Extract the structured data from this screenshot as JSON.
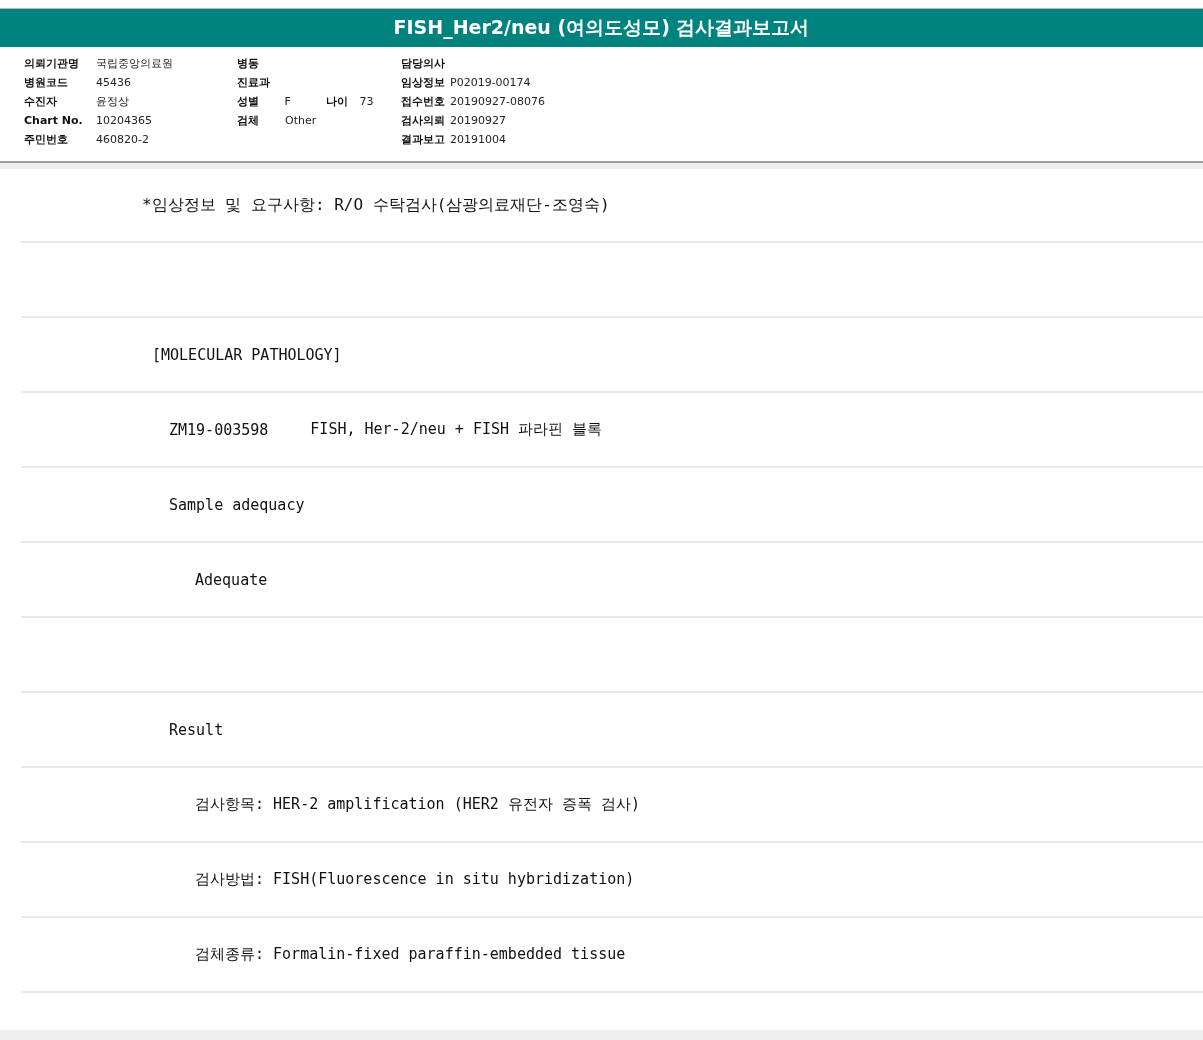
{
  "title": "FISH_Her2/neu (여의도성모) 검사결과보고서",
  "info": [
    [
      {
        "label": "의뢰기관명",
        "value": "국립중앙의료원"
      },
      {
        "label": "병원코드",
        "value": "45436"
      },
      {
        "label": "수진자",
        "value": "윤정상"
      },
      {
        "label": "Chart No.",
        "value": "10204365"
      },
      {
        "label": "주민번호",
        "value": "460820-2"
      }
    ],
    [
      {
        "label": "병동"
      },
      {
        "label": "진료과"
      },
      {
        "label": "성별",
        "value": "F",
        "extra_label": "나이",
        "extra_value": "73"
      },
      {
        "label": "검체",
        "value": "Other"
      }
    ],
    [
      {
        "label": "담당의사"
      },
      {
        "label": "임상정보",
        "value": "P02019-00174"
      },
      {
        "label": "접수번호",
        "value": "20190927-08076"
      },
      {
        "label": "검사의뢰",
        "value": "20190927"
      },
      {
        "label": "결과보고",
        "value": "20191004"
      }
    ]
  ],
  "report": [
    {
      "kind": "note",
      "text": "*임상정보 및 요구사항: R/O 수탁검사(삼광의료재단-조영숙)"
    },
    {
      "kind": "blank"
    },
    {
      "kind": "heading",
      "text": "[MOLECULAR PATHOLOGY]"
    },
    {
      "kind": "item",
      "code": "ZM19-003598",
      "text": "FISH, Her-2/neu + FISH 파라핀 블록"
    },
    {
      "kind": "item",
      "text": "Sample adequacy"
    },
    {
      "kind": "detail",
      "text": "Adequate"
    },
    {
      "kind": "blank"
    },
    {
      "kind": "item",
      "text": "Result"
    },
    {
      "kind": "detail",
      "text": "검사항목: HER-2 amplification (HER2 유전자 증폭 검사)"
    },
    {
      "kind": "detail",
      "text": "검사방법: FISH(Fluorescence in situ hybridization)"
    },
    {
      "kind": "detail",
      "text": "검체종류: Formalin-fixed paraffin-embedded tissue"
    }
  ]
}
